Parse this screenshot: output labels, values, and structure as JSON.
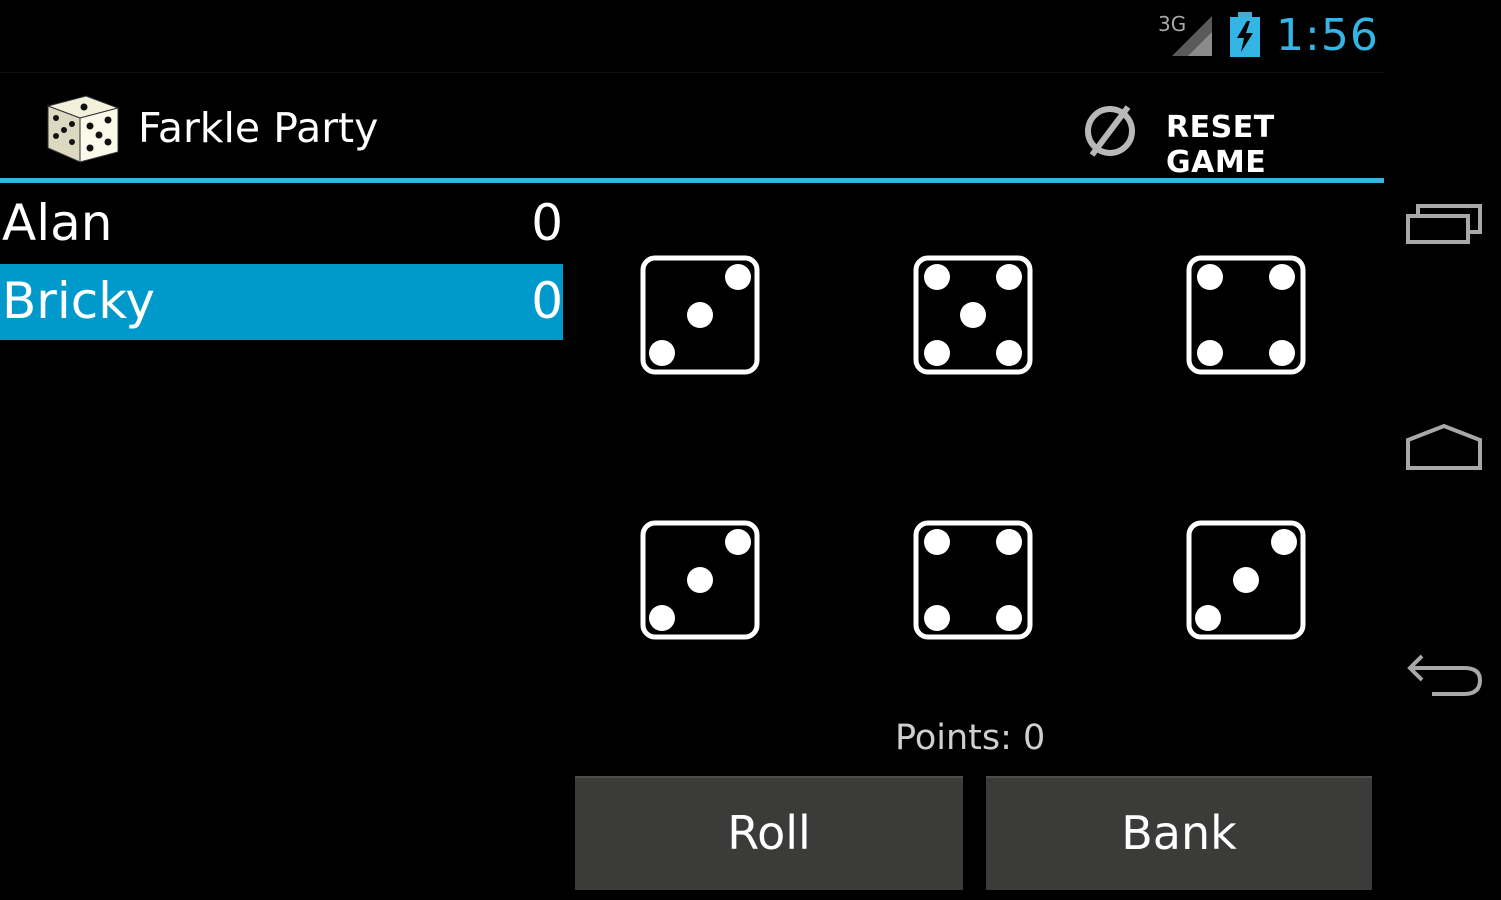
{
  "status_bar": {
    "network_label": "3G",
    "time": "1:56",
    "accent_color": "#33b5e5"
  },
  "action_bar": {
    "title": "Farkle Party",
    "app_icon": "dice-icon",
    "reset_icon": "no-entry-icon",
    "reset_label": "RESET GAME",
    "divider_color": "#33b5e5"
  },
  "players": [
    {
      "name": "Alan",
      "score": "0",
      "selected": false
    },
    {
      "name": "Bricky",
      "score": "0",
      "selected": true
    }
  ],
  "dice": [
    {
      "value": 3
    },
    {
      "value": 5
    },
    {
      "value": 4
    },
    {
      "value": 3
    },
    {
      "value": 4
    },
    {
      "value": 3
    }
  ],
  "points": {
    "label": "Points: 0"
  },
  "buttons": {
    "roll_label": "Roll",
    "bank_label": "Bank"
  },
  "navigation": {
    "recent_apps_icon": "recent-apps-icon",
    "home_icon": "home-icon",
    "back_icon": "back-icon"
  },
  "colors": {
    "selected_row": "#0099cc",
    "button_bg": "#3b3b3a"
  }
}
